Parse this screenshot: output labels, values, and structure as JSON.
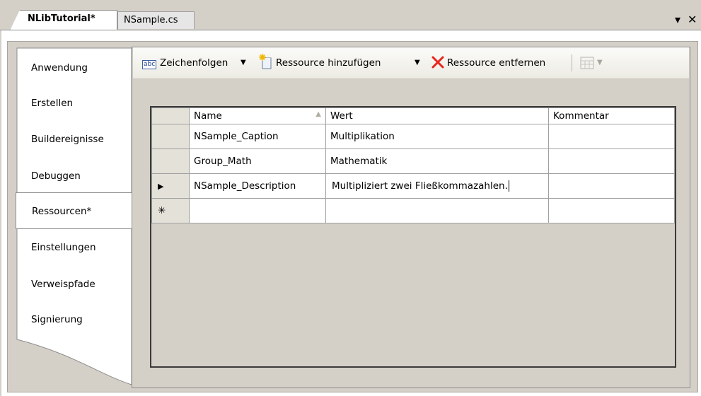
{
  "tabs": [
    {
      "label": "NLibTutorial*",
      "active": true
    },
    {
      "label": "NSample.cs",
      "active": false
    }
  ],
  "window_buttons": {
    "dropdown": "▾",
    "close": "✕"
  },
  "nav": {
    "items": [
      {
        "label": "Anwendung"
      },
      {
        "label": "Erstellen"
      },
      {
        "label": "Buildereignisse"
      },
      {
        "label": "Debuggen"
      },
      {
        "label": "Ressourcen*"
      },
      {
        "label": "Einstellungen"
      },
      {
        "label": "Verweispfade"
      },
      {
        "label": "Signierung"
      }
    ],
    "selected": "Ressourcen*"
  },
  "toolbar": {
    "strings_label": "Zeichenfolgen",
    "add_label": "Ressource hinzufügen",
    "remove_label": "Ressource entfernen",
    "strings_icon_text": "abc"
  },
  "grid": {
    "columns": [
      "Name",
      "Wert",
      "Kommentar"
    ],
    "rows": [
      {
        "marker": "",
        "name": "NSample_Caption",
        "value": "Multiplikation",
        "comment": ""
      },
      {
        "marker": "",
        "name": "Group_Math",
        "value": "Mathematik",
        "comment": ""
      },
      {
        "marker": "▶",
        "name": "NSample_Description",
        "value": "Multipliziert zwei Fließkommazahlen.",
        "comment": ""
      },
      {
        "marker": "✳",
        "name": "",
        "value": "",
        "comment": ""
      }
    ]
  },
  "colors": {
    "background": "#d4d0c8",
    "remove_icon": "#e8251c",
    "grid_border": "#3a3a3a"
  }
}
